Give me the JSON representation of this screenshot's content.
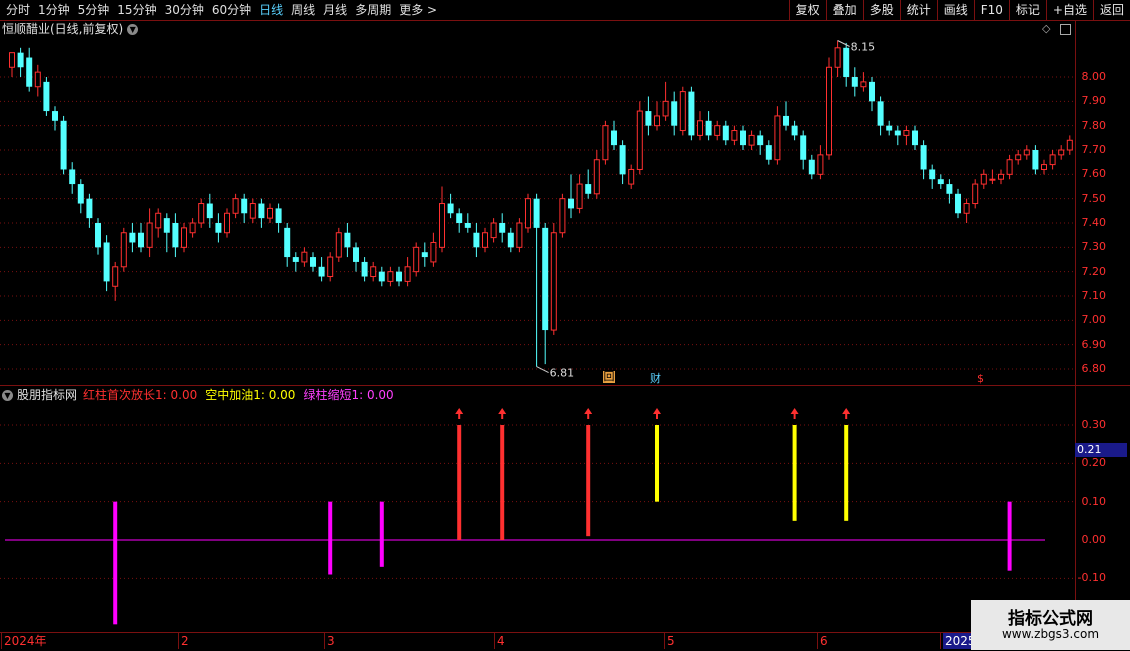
{
  "toolbar": {
    "timeframes": [
      "分时",
      "1分钟",
      "5分钟",
      "15分钟",
      "30分钟",
      "60分钟",
      "日线",
      "周线",
      "月线",
      "多周期",
      "更多"
    ],
    "active_index": 6,
    "more_arrow": ">",
    "tools": [
      "复权",
      "叠加",
      "多股",
      "统计",
      "画线",
      "F10",
      "标记",
      "+自选",
      "返回"
    ]
  },
  "stock": {
    "title": "恒顺醋业(日线,前复权)",
    "high_label": "8.15",
    "low_label": "6.81",
    "marker_hui": "回",
    "marker_cai": "财",
    "marker_dollar": "$"
  },
  "price_axis": [
    "8.00",
    "7.90",
    "7.80",
    "7.70",
    "7.60",
    "7.50",
    "7.40",
    "7.30",
    "7.20",
    "7.10",
    "7.00",
    "6.90",
    "6.80"
  ],
  "indicator": {
    "name": "股朋指标网",
    "items": [
      {
        "label": "红柱首次放长1: 0.00",
        "color": "#ff3030"
      },
      {
        "label": "空中加油1: 0.00",
        "color": "#ffff00"
      },
      {
        "label": "绿柱缩短1: 0.00",
        "color": "#ff40ff"
      }
    ],
    "axis": [
      "0.30",
      "0.20",
      "0.10",
      "0.00",
      "-0.10"
    ],
    "current_value": "0.21"
  },
  "time_axis": [
    "2024年",
    "2",
    "3",
    "4",
    "5",
    "6",
    "2025"
  ],
  "watermark": {
    "line1": "指标公式网",
    "line2": "www.zbgs3.com"
  },
  "colors": {
    "up": "#ff3030",
    "down": "#54ffff",
    "grid": "#7a1010",
    "magenta": "#ff00ff",
    "yellow": "#ffff00"
  },
  "chart_data": {
    "type": "candlestick",
    "ylim": [
      6.78,
      8.17
    ],
    "indicator_ylim": [
      -0.22,
      0.35
    ],
    "high_label_value": 8.15,
    "low_label_value": 6.81,
    "candles": [
      [
        8.04,
        8.1,
        8.05,
        8.0
      ],
      [
        8.1,
        8.04,
        8.12,
        8.0
      ],
      [
        8.08,
        7.96,
        8.12,
        7.94
      ],
      [
        7.96,
        8.02,
        8.05,
        7.92
      ],
      [
        7.98,
        7.86,
        8.0,
        7.84
      ],
      [
        7.86,
        7.82,
        7.88,
        7.78
      ],
      [
        7.82,
        7.62,
        7.84,
        7.6
      ],
      [
        7.62,
        7.56,
        7.65,
        7.52
      ],
      [
        7.56,
        7.48,
        7.58,
        7.44
      ],
      [
        7.5,
        7.42,
        7.52,
        7.38
      ],
      [
        7.4,
        7.3,
        7.42,
        7.27
      ],
      [
        7.32,
        7.16,
        7.35,
        7.12
      ],
      [
        7.14,
        7.22,
        7.24,
        7.08
      ],
      [
        7.22,
        7.36,
        7.38,
        7.2
      ],
      [
        7.36,
        7.32,
        7.4,
        7.28
      ],
      [
        7.36,
        7.3,
        7.4,
        7.28
      ],
      [
        7.3,
        7.4,
        7.46,
        7.26
      ],
      [
        7.38,
        7.44,
        7.46,
        7.34
      ],
      [
        7.42,
        7.36,
        7.44,
        7.28
      ],
      [
        7.4,
        7.3,
        7.44,
        7.26
      ],
      [
        7.3,
        7.38,
        7.4,
        7.28
      ],
      [
        7.36,
        7.4,
        7.42,
        7.34
      ],
      [
        7.4,
        7.48,
        7.5,
        7.38
      ],
      [
        7.48,
        7.42,
        7.52,
        7.38
      ],
      [
        7.4,
        7.36,
        7.44,
        7.32
      ],
      [
        7.36,
        7.44,
        7.46,
        7.34
      ],
      [
        7.44,
        7.5,
        7.52,
        7.42
      ],
      [
        7.5,
        7.44,
        7.52,
        7.4
      ],
      [
        7.42,
        7.48,
        7.5,
        7.4
      ],
      [
        7.48,
        7.42,
        7.5,
        7.38
      ],
      [
        7.42,
        7.46,
        7.48,
        7.4
      ],
      [
        7.46,
        7.4,
        7.48,
        7.36
      ],
      [
        7.38,
        7.26,
        7.4,
        7.22
      ],
      [
        7.26,
        7.24,
        7.28,
        7.2
      ],
      [
        7.24,
        7.28,
        7.3,
        7.22
      ],
      [
        7.26,
        7.22,
        7.28,
        7.2
      ],
      [
        7.22,
        7.18,
        7.26,
        7.16
      ],
      [
        7.18,
        7.26,
        7.28,
        7.16
      ],
      [
        7.26,
        7.36,
        7.38,
        7.24
      ],
      [
        7.36,
        7.3,
        7.4,
        7.26
      ],
      [
        7.3,
        7.24,
        7.32,
        7.2
      ],
      [
        7.24,
        7.18,
        7.26,
        7.16
      ],
      [
        7.18,
        7.22,
        7.24,
        7.16
      ],
      [
        7.2,
        7.16,
        7.22,
        7.14
      ],
      [
        7.16,
        7.2,
        7.22,
        7.14
      ],
      [
        7.2,
        7.16,
        7.22,
        7.14
      ],
      [
        7.16,
        7.22,
        7.26,
        7.14
      ],
      [
        7.2,
        7.3,
        7.32,
        7.18
      ],
      [
        7.28,
        7.26,
        7.32,
        7.22
      ],
      [
        7.24,
        7.32,
        7.36,
        7.22
      ],
      [
        7.3,
        7.48,
        7.55,
        7.28
      ],
      [
        7.48,
        7.44,
        7.52,
        7.42
      ],
      [
        7.44,
        7.4,
        7.46,
        7.36
      ],
      [
        7.4,
        7.38,
        7.44,
        7.36
      ],
      [
        7.36,
        7.3,
        7.4,
        7.26
      ],
      [
        7.3,
        7.36,
        7.38,
        7.28
      ],
      [
        7.34,
        7.4,
        7.42,
        7.32
      ],
      [
        7.4,
        7.36,
        7.44,
        7.32
      ],
      [
        7.36,
        7.3,
        7.38,
        7.28
      ],
      [
        7.3,
        7.4,
        7.42,
        7.28
      ],
      [
        7.38,
        7.5,
        7.52,
        7.36
      ],
      [
        7.5,
        7.38,
        7.52,
        6.81
      ],
      [
        7.38,
        6.96,
        7.4,
        6.82
      ],
      [
        6.96,
        7.36,
        7.4,
        6.94
      ],
      [
        7.36,
        7.5,
        7.52,
        7.34
      ],
      [
        7.5,
        7.46,
        7.6,
        7.42
      ],
      [
        7.46,
        7.56,
        7.6,
        7.44
      ],
      [
        7.56,
        7.52,
        7.62,
        7.5
      ],
      [
        7.52,
        7.66,
        7.7,
        7.5
      ],
      [
        7.66,
        7.8,
        7.82,
        7.64
      ],
      [
        7.78,
        7.72,
        7.82,
        7.7
      ],
      [
        7.72,
        7.6,
        7.74,
        7.56
      ],
      [
        7.56,
        7.62,
        7.64,
        7.54
      ],
      [
        7.62,
        7.86,
        7.9,
        7.6
      ],
      [
        7.86,
        7.8,
        7.92,
        7.76
      ],
      [
        7.8,
        7.84,
        7.9,
        7.78
      ],
      [
        7.84,
        7.9,
        7.98,
        7.82
      ],
      [
        7.9,
        7.8,
        7.94,
        7.76
      ],
      [
        7.78,
        7.94,
        7.96,
        7.76
      ],
      [
        7.94,
        7.76,
        7.96,
        7.74
      ],
      [
        7.76,
        7.82,
        7.86,
        7.74
      ],
      [
        7.82,
        7.76,
        7.86,
        7.74
      ],
      [
        7.76,
        7.8,
        7.82,
        7.74
      ],
      [
        7.8,
        7.74,
        7.82,
        7.72
      ],
      [
        7.74,
        7.78,
        7.8,
        7.72
      ],
      [
        7.78,
        7.72,
        7.8,
        7.7
      ],
      [
        7.72,
        7.76,
        7.78,
        7.7
      ],
      [
        7.76,
        7.72,
        7.78,
        7.68
      ],
      [
        7.72,
        7.66,
        7.74,
        7.64
      ],
      [
        7.66,
        7.84,
        7.88,
        7.64
      ],
      [
        7.84,
        7.8,
        7.9,
        7.78
      ],
      [
        7.8,
        7.76,
        7.82,
        7.74
      ],
      [
        7.76,
        7.66,
        7.78,
        7.62
      ],
      [
        7.66,
        7.6,
        7.68,
        7.58
      ],
      [
        7.6,
        7.68,
        7.72,
        7.58
      ],
      [
        7.68,
        8.04,
        8.08,
        7.66
      ],
      [
        8.04,
        8.12,
        8.15,
        8.0
      ],
      [
        8.12,
        8.0,
        8.14,
        7.96
      ],
      [
        8.0,
        7.96,
        8.04,
        7.92
      ],
      [
        7.96,
        7.98,
        8.02,
        7.94
      ],
      [
        7.98,
        7.9,
        8.0,
        7.86
      ],
      [
        7.9,
        7.8,
        7.92,
        7.76
      ],
      [
        7.8,
        7.78,
        7.82,
        7.76
      ],
      [
        7.78,
        7.76,
        7.8,
        7.72
      ],
      [
        7.76,
        7.78,
        7.8,
        7.72
      ],
      [
        7.78,
        7.72,
        7.8,
        7.7
      ],
      [
        7.72,
        7.62,
        7.74,
        7.58
      ],
      [
        7.62,
        7.58,
        7.64,
        7.54
      ],
      [
        7.58,
        7.56,
        7.6,
        7.54
      ],
      [
        7.56,
        7.52,
        7.58,
        7.48
      ],
      [
        7.52,
        7.44,
        7.54,
        7.42
      ],
      [
        7.44,
        7.48,
        7.5,
        7.4
      ],
      [
        7.48,
        7.56,
        7.58,
        7.46
      ],
      [
        7.56,
        7.6,
        7.62,
        7.54
      ],
      [
        7.58,
        7.58,
        7.62,
        7.56
      ],
      [
        7.58,
        7.6,
        7.62,
        7.56
      ],
      [
        7.6,
        7.66,
        7.68,
        7.58
      ],
      [
        7.66,
        7.68,
        7.7,
        7.64
      ],
      [
        7.68,
        7.7,
        7.72,
        7.66
      ],
      [
        7.7,
        7.62,
        7.72,
        7.6
      ],
      [
        7.62,
        7.64,
        7.66,
        7.6
      ],
      [
        7.64,
        7.68,
        7.7,
        7.62
      ],
      [
        7.68,
        7.7,
        7.72,
        7.66
      ],
      [
        7.7,
        7.74,
        7.76,
        7.68
      ]
    ],
    "signals": [
      {
        "i": 12,
        "color": "magenta",
        "from": -0.22,
        "to": 0.1,
        "arrow": false
      },
      {
        "i": 37,
        "color": "magenta",
        "from": -0.09,
        "to": 0.1,
        "arrow": false
      },
      {
        "i": 43,
        "color": "magenta",
        "from": -0.07,
        "to": 0.1,
        "arrow": false
      },
      {
        "i": 52,
        "color": "red",
        "from": 0.0,
        "to": 0.3,
        "arrow": true
      },
      {
        "i": 57,
        "color": "red",
        "from": 0.0,
        "to": 0.3,
        "arrow": true
      },
      {
        "i": 67,
        "color": "red",
        "from": 0.01,
        "to": 0.3,
        "arrow": true
      },
      {
        "i": 75,
        "color": "yellow",
        "from": 0.1,
        "to": 0.3,
        "arrow": true
      },
      {
        "i": 91,
        "color": "yellow",
        "from": 0.05,
        "to": 0.3,
        "arrow": true
      },
      {
        "i": 97,
        "color": "yellow",
        "from": 0.05,
        "to": 0.3,
        "arrow": true
      },
      {
        "i": 116,
        "color": "magenta",
        "from": -0.08,
        "to": 0.1,
        "arrow": false
      }
    ]
  }
}
